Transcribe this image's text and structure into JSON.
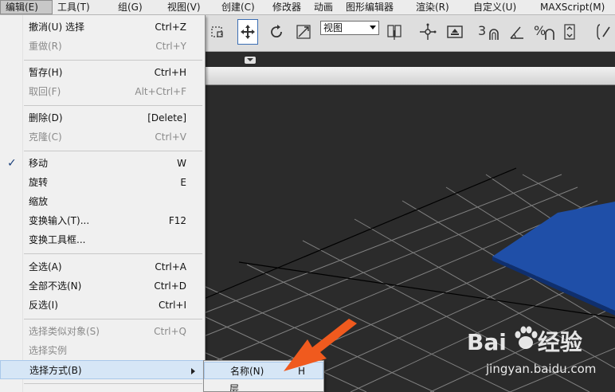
{
  "menubar": {
    "items": [
      {
        "label": "编辑(E)",
        "active": true
      },
      {
        "label": "工具(T)"
      },
      {
        "label": "组(G)"
      },
      {
        "label": "视图(V)"
      },
      {
        "label": "创建(C)"
      },
      {
        "label": "修改器"
      },
      {
        "label": "动画"
      },
      {
        "label": "图形编辑器"
      },
      {
        "label": "渲染(R)"
      },
      {
        "label": "自定义(U)"
      },
      {
        "label": "MAXScript(M)"
      }
    ]
  },
  "toolbar": {
    "view_select": "视图",
    "snap_3": "3",
    "snap_percent": "%"
  },
  "edit_menu": {
    "undo": {
      "label": "撤消(U) 选择",
      "shortcut": "Ctrl+Z"
    },
    "redo": {
      "label": "重做(R)",
      "shortcut": "Ctrl+Y"
    },
    "hold": {
      "label": "暂存(H)",
      "shortcut": "Ctrl+H"
    },
    "fetch": {
      "label": "取回(F)",
      "shortcut": "Alt+Ctrl+F"
    },
    "delete": {
      "label": "删除(D)",
      "shortcut": "[Delete]"
    },
    "clone": {
      "label": "克隆(C)",
      "shortcut": "Ctrl+V"
    },
    "move": {
      "label": "移动",
      "shortcut": "W"
    },
    "rotate": {
      "label": "旋转",
      "shortcut": "E"
    },
    "scale": {
      "label": "缩放"
    },
    "transform_typein": {
      "label": "变换输入(T)...",
      "shortcut": "F12"
    },
    "transform_toolbox": {
      "label": "变换工具框..."
    },
    "select_all": {
      "label": "全选(A)",
      "shortcut": "Ctrl+A"
    },
    "select_none": {
      "label": "全部不选(N)",
      "shortcut": "Ctrl+D"
    },
    "select_invert": {
      "label": "反选(I)",
      "shortcut": "Ctrl+I"
    },
    "select_similar": {
      "label": "选择类似对象(S)",
      "shortcut": "Ctrl+Q"
    },
    "select_instances": {
      "label": "选择实例"
    },
    "select_by": {
      "label": "选择方式(B)"
    }
  },
  "select_by_submenu": {
    "name": {
      "label": "名称(N)",
      "shortcut": "H"
    },
    "layer": {
      "label": "层"
    }
  },
  "watermark": {
    "url": "jingyan.baidu.com"
  },
  "colors": {
    "menu_bg": "#f0f0f0",
    "highlight": "#d6e6f6",
    "viewport_bg": "#2b2b2b",
    "plane_blue": "#1f4fa8",
    "arrow_orange": "#f05a1e"
  }
}
